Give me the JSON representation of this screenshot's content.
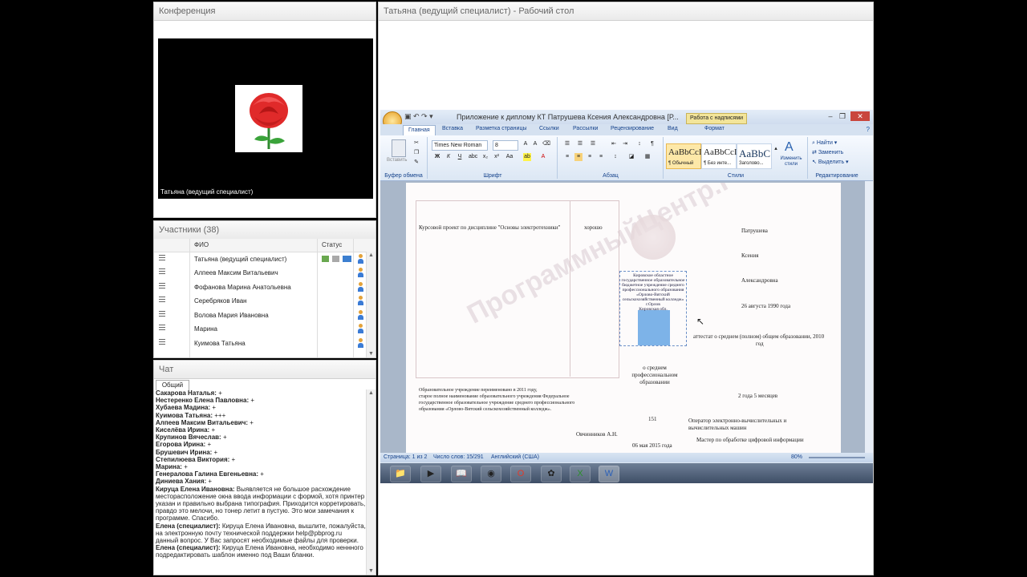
{
  "conference": {
    "title": "Конференция",
    "speaker_label": "Татьяна (ведущий специалист)"
  },
  "participants": {
    "title": "Участники (38)",
    "col_name": "ФИО",
    "col_status": "Статус",
    "rows": [
      "Татьяна (ведущий специалист)",
      "Алпеев Максим Витальевич",
      "Фофанова Марина Анатольевна",
      "Серебряков Иван",
      "Волова Мария   Ивановна",
      "Марина",
      "Куимова Татьяна"
    ]
  },
  "chat": {
    "title": "Чат",
    "tab": "Общий",
    "lines": [
      {
        "author": "Сакарова Наталья:",
        "text": " +"
      },
      {
        "author": "Нестеренко  Елена   Павловна:",
        "text": " +"
      },
      {
        "author": "Хубаева Мадина:",
        "text": " +"
      },
      {
        "author": "Куимова Татьяна:",
        "text": " +++"
      },
      {
        "author": "Алпеев Максим Витальевич:",
        "text": " +"
      },
      {
        "author": "Киселёва Ирина:",
        "text": " +"
      },
      {
        "author": "Крупинов Вячеслав:",
        "text": " +"
      },
      {
        "author": "Егорова Ирина:",
        "text": " +"
      },
      {
        "author": "Брушевич Ирина:",
        "text": " +"
      },
      {
        "author": "Степилюева Виктория:",
        "text": " +"
      },
      {
        "author": "Марина:",
        "text": " +"
      },
      {
        "author": "Генералова Галина Евгеньевна:",
        "text": " +"
      },
      {
        "author": "Диниева  Хания:",
        "text": " +"
      },
      {
        "author": "Кируца  Елена Ивановна:",
        "text": " Выявляется не большое расхождение месторасположение окна ввода информации с формой, хотя принтер указан и правильно выбрана типография. Приходится корретировать, правдо это мелочи, но тонер летит в пустую. Это мои замечания к программе. Спасибо."
      },
      {
        "author": "Елена (специалист):",
        "text": " Кируца  Елена Ивановна, вышлите, пожалуйста, на электронную почту технической поддержки help@pbprog.ru данный вопрос. У Вас запросят необходимые файлы для проверки."
      },
      {
        "author": "Елена (специалист):",
        "text": " Кируца  Елена Ивановна, необходимо неннного подредактировать шаблон именно под Ваши бланки."
      }
    ]
  },
  "desktop": {
    "title": "Татьяна (ведущий специалист) - Рабочий стол"
  },
  "word": {
    "title": "Приложение к диплому КТ Патрушева Ксения Александровна [Р...",
    "context_tab": "Работа с надписями",
    "tabs": [
      "Главная",
      "Вставка",
      "Разметка страницы",
      "Ссылки",
      "Рассылки",
      "Рецензирование",
      "Вид",
      "Формат"
    ],
    "groups": {
      "clipboard": "Буфер обмена",
      "paste": "Вставить",
      "font": "Шрифт",
      "paragraph": "Абзац",
      "styles": "Стили",
      "editing": "Редактирование"
    },
    "font_name": "Times New Roman",
    "font_size": "8",
    "styles": [
      {
        "preview": "AaBbCcI",
        "name": "¶ Обычный"
      },
      {
        "preview": "AaBbCcI",
        "name": "¶ Без инте..."
      },
      {
        "preview": "AaBbC",
        "name": "Заголово..."
      }
    ],
    "change_styles": "Изменить стили",
    "find": "Найти",
    "replace": "Заменить",
    "select": "Выделить",
    "status": {
      "page": "Страница: 1 из 2",
      "words": "Число слов: 15/291",
      "lang": "Английский (США)",
      "zoom": "80%"
    }
  },
  "document": {
    "course_text": "Курсовой проект по дисциплине \"Основы электротехники\"",
    "grade": "хорошо",
    "reorg_text": "Образовательное учреждение переименовано в 2011 году,",
    "reorg_text2": "старое полное наименование образовательного учреждения Федеральное",
    "reorg_text3": "государственное образовательное учреждение среднего профессионального",
    "reorg_text4": "образования «Орлово-Вятский сельскохозяйственный колледж».",
    "surname": "Патрушева",
    "name": "Ксения",
    "patronymic": "Александровна",
    "birth": "26 августа 1990 года",
    "prev_edu": "аттестат о среднем (полном) общем образовании, 2010",
    "prev_edu2": "год",
    "duration": "2 года 5 месяцев",
    "qual1": "Оператор          электронно-вычислительных          и",
    "qual2": "вычислительных машин",
    "qual3": "Мастер по обработке цифровой информации",
    "level1": "о среднем",
    "level2": "профессиональном",
    "level3": "образовании",
    "reg_num": "151",
    "director": "Овчинников А.Н.",
    "issue_date": "06 мая 2015 года",
    "textbox_lines": [
      "Кировское областное",
      "государственное образовательное",
      "бюджетное учреждение среднего",
      "профессионального образования",
      "«Орлово-Вятский",
      "сельскохозяйственный колледж»",
      "г.Орлов",
      "Кировская обл."
    ],
    "watermark": "ПрограммныйЦентр.РФ"
  }
}
